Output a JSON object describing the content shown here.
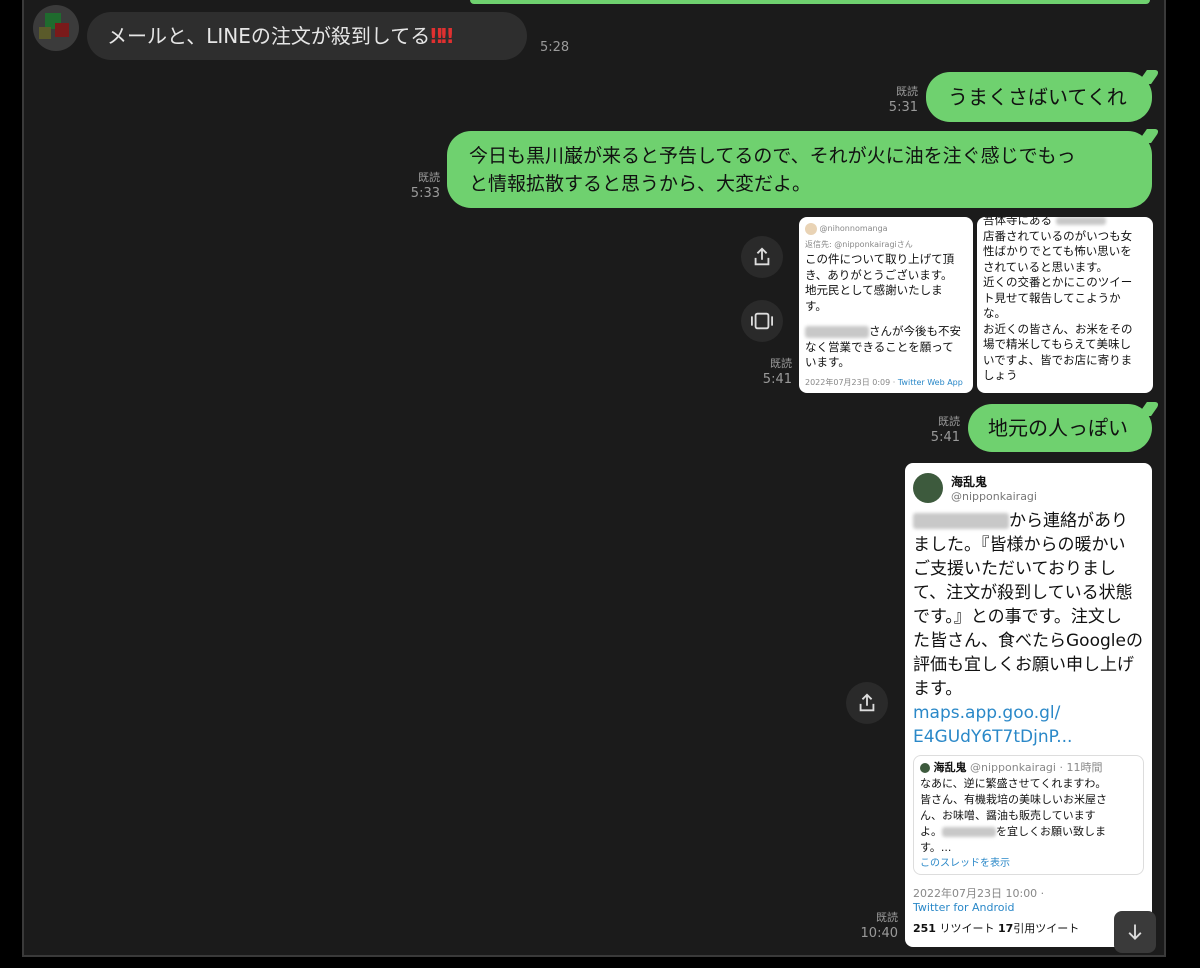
{
  "messages": {
    "m1": {
      "text": "メールと、LINEの注文が殺到してる",
      "emoji": "‼‼",
      "time": "5:28"
    },
    "m2": {
      "text": "うまくさばいてくれ",
      "read": "既読",
      "time": "5:31"
    },
    "m3": {
      "line1": "今日も黒川巌が来ると予告してるので、それが火に油を注ぐ感じでもっ",
      "line2": "と情報拡散すると思うから、大変だよ。",
      "read": "既読",
      "time": "5:33"
    },
    "m4": {
      "read": "既読",
      "time": "5:41"
    },
    "m5": {
      "text": "地元の人っぽい",
      "read": "既読",
      "time": "5:41"
    },
    "m6": {
      "read": "既読",
      "time": "10:40"
    }
  },
  "tweet_left": {
    "handle": "@nihonnomanga",
    "reply_to": "返信先: @nipponkairagiさん",
    "body": [
      "この件について取り上げて頂",
      "き、ありがとうございます。",
      "地元民として感謝いたしま",
      "す。"
    ],
    "body2_suffix": "さんが今後も不安",
    "body2": [
      "なく営業できることを願って",
      "います。"
    ],
    "date": "2022年07月23日 0:09 · ",
    "via": "Twitter Web App"
  },
  "tweet_right": {
    "lines": [
      "吾体寺にある",
      "店番されているのがいつも女",
      "性ばかりでとても怖い思いを",
      "されていると思います。",
      "近くの交番とかにこのツイー",
      "ト見せて報告してこようか",
      "な。",
      "お近くの皆さん、お米をその",
      "場で精米してもらえて美味し",
      "いですよ、皆でお店に寄りま",
      "しょう"
    ]
  },
  "tweet_big": {
    "name": "海乱鬼",
    "handle": "@nipponkairagi",
    "first_suffix": "から連絡があり",
    "lines": [
      "ました。『皆様からの暖かい",
      "ご支援いただいておりまし",
      "て、注文が殺到している状態",
      "です。』との事です。注文し",
      "た皆さん、食べたらGoogleの",
      "評価も宜しくお願い申し上げ",
      "ます。"
    ],
    "link1": "maps.app.goo.gl/",
    "link2": "E4GUdY6T7tDjnP...",
    "quote_name": "海乱鬼",
    "quote_handle": "@nipponkairagi · 11時間",
    "quote_lines": [
      "なあに、逆に繁盛させてくれますわ。",
      "皆さん、有機栽培の美味しいお米屋さ",
      "ん、お味噌、醤油も販売しています",
      "を宜しくお願い致しま",
      "す。..."
    ],
    "quote_prefix": "よ。",
    "show_thread": "このスレッドを表示",
    "date": "2022年07月23日 10:00 ·",
    "via": "Twitter for Android",
    "rt_count": "251",
    "rt_label": "リツイート",
    "qt_count": "17",
    "qt_label": "引用ツイート"
  },
  "icons": {
    "share": "share-icon",
    "gallery": "gallery-icon",
    "scroll": "arrow-down-icon"
  },
  "colors": {
    "bubble_out": "#6fd16f",
    "bubble_in": "#2e2e2e",
    "background": "#1b1b1b"
  }
}
